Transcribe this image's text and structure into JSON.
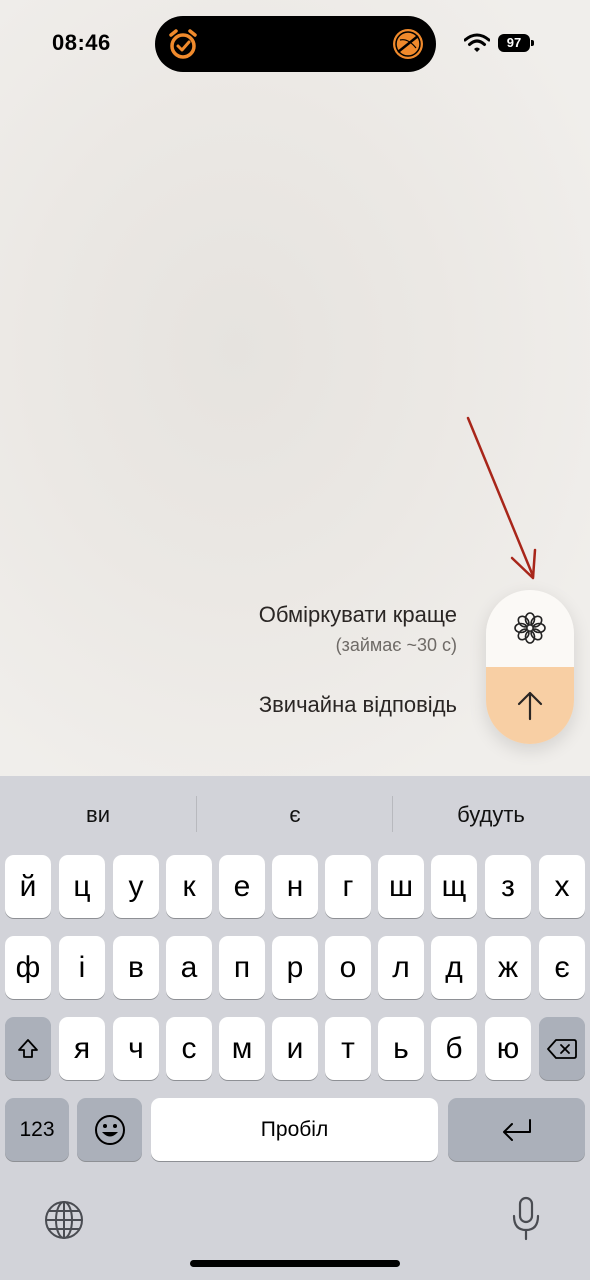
{
  "status_bar": {
    "time": "08:46",
    "battery": "97",
    "icons": [
      "alarm-icon",
      "focus-icon",
      "wifi-icon",
      "battery-icon"
    ]
  },
  "mode_menu": {
    "think_label": "Обміркувати краще",
    "think_sub": "(займає ~30 с)",
    "normal_label": "Звичайна відповідь",
    "icons": [
      "flower-icon",
      "arrow-up-icon"
    ],
    "colors": {
      "accent": "#f8cfa4",
      "island_accent": "#f08a2c",
      "annotation": "#a8261a"
    }
  },
  "keyboard": {
    "suggestions": [
      "ви",
      "є",
      "будуть"
    ],
    "row1": [
      "й",
      "ц",
      "у",
      "к",
      "е",
      "н",
      "г",
      "ш",
      "щ",
      "з",
      "х"
    ],
    "row2": [
      "ф",
      "і",
      "в",
      "а",
      "п",
      "р",
      "о",
      "л",
      "д",
      "ж",
      "є"
    ],
    "row3": [
      "я",
      "ч",
      "с",
      "м",
      "и",
      "т",
      "ь",
      "б",
      "ю"
    ],
    "numbers_label": "123",
    "space_label": "Пробіл",
    "icons": [
      "shift-icon",
      "delete-icon",
      "emoji-icon",
      "return-icon",
      "globe-icon",
      "mic-icon"
    ]
  }
}
